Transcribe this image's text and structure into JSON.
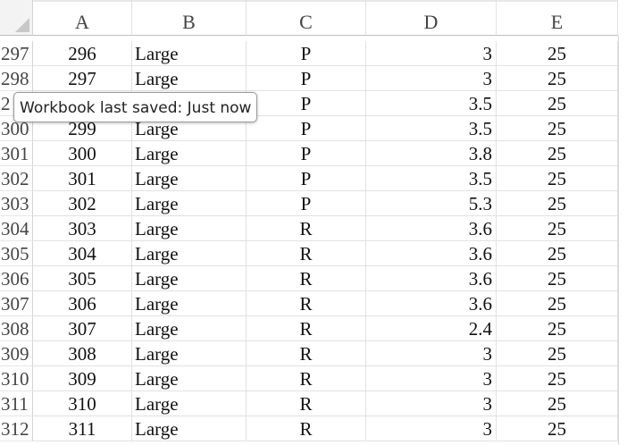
{
  "columns": [
    {
      "letter": "A"
    },
    {
      "letter": "B"
    },
    {
      "letter": "C"
    },
    {
      "letter": "D"
    },
    {
      "letter": "E"
    }
  ],
  "rows": [
    {
      "num": "297",
      "a": "296",
      "b": "Large",
      "c": "P",
      "d": "3",
      "e": "25"
    },
    {
      "num": "298",
      "a": "297",
      "b": "Large",
      "c": "P",
      "d": "3",
      "e": "25"
    },
    {
      "num": "2",
      "a": "",
      "b": "",
      "c": "P",
      "d": "3.5",
      "e": "25"
    },
    {
      "num": "300",
      "a": "299",
      "b": "Large",
      "c": "P",
      "d": "3.5",
      "e": "25"
    },
    {
      "num": "301",
      "a": "300",
      "b": "Large",
      "c": "P",
      "d": "3.8",
      "e": "25"
    },
    {
      "num": "302",
      "a": "301",
      "b": "Large",
      "c": "P",
      "d": "3.5",
      "e": "25"
    },
    {
      "num": "303",
      "a": "302",
      "b": "Large",
      "c": "P",
      "d": "5.3",
      "e": "25"
    },
    {
      "num": "304",
      "a": "303",
      "b": "Large",
      "c": "R",
      "d": "3.6",
      "e": "25"
    },
    {
      "num": "305",
      "a": "304",
      "b": "Large",
      "c": "R",
      "d": "3.6",
      "e": "25"
    },
    {
      "num": "306",
      "a": "305",
      "b": "Large",
      "c": "R",
      "d": "3.6",
      "e": "25"
    },
    {
      "num": "307",
      "a": "306",
      "b": "Large",
      "c": "R",
      "d": "3.6",
      "e": "25"
    },
    {
      "num": "308",
      "a": "307",
      "b": "Large",
      "c": "R",
      "d": "2.4",
      "e": "25"
    },
    {
      "num": "309",
      "a": "308",
      "b": "Large",
      "c": "R",
      "d": "3",
      "e": "25"
    },
    {
      "num": "310",
      "a": "309",
      "b": "Large",
      "c": "R",
      "d": "3",
      "e": "25"
    },
    {
      "num": "311",
      "a": "310",
      "b": "Large",
      "c": "R",
      "d": "3",
      "e": "25"
    },
    {
      "num": "312",
      "a": "311",
      "b": "Large",
      "c": "R",
      "d": "3",
      "e": "25"
    }
  ],
  "tooltip": {
    "text": "Workbook last saved: Just now"
  },
  "colors": {
    "header_bg": "#f3f3f3",
    "gridline": "#e1e1e1",
    "tooltip_border": "#9a9a9a"
  }
}
